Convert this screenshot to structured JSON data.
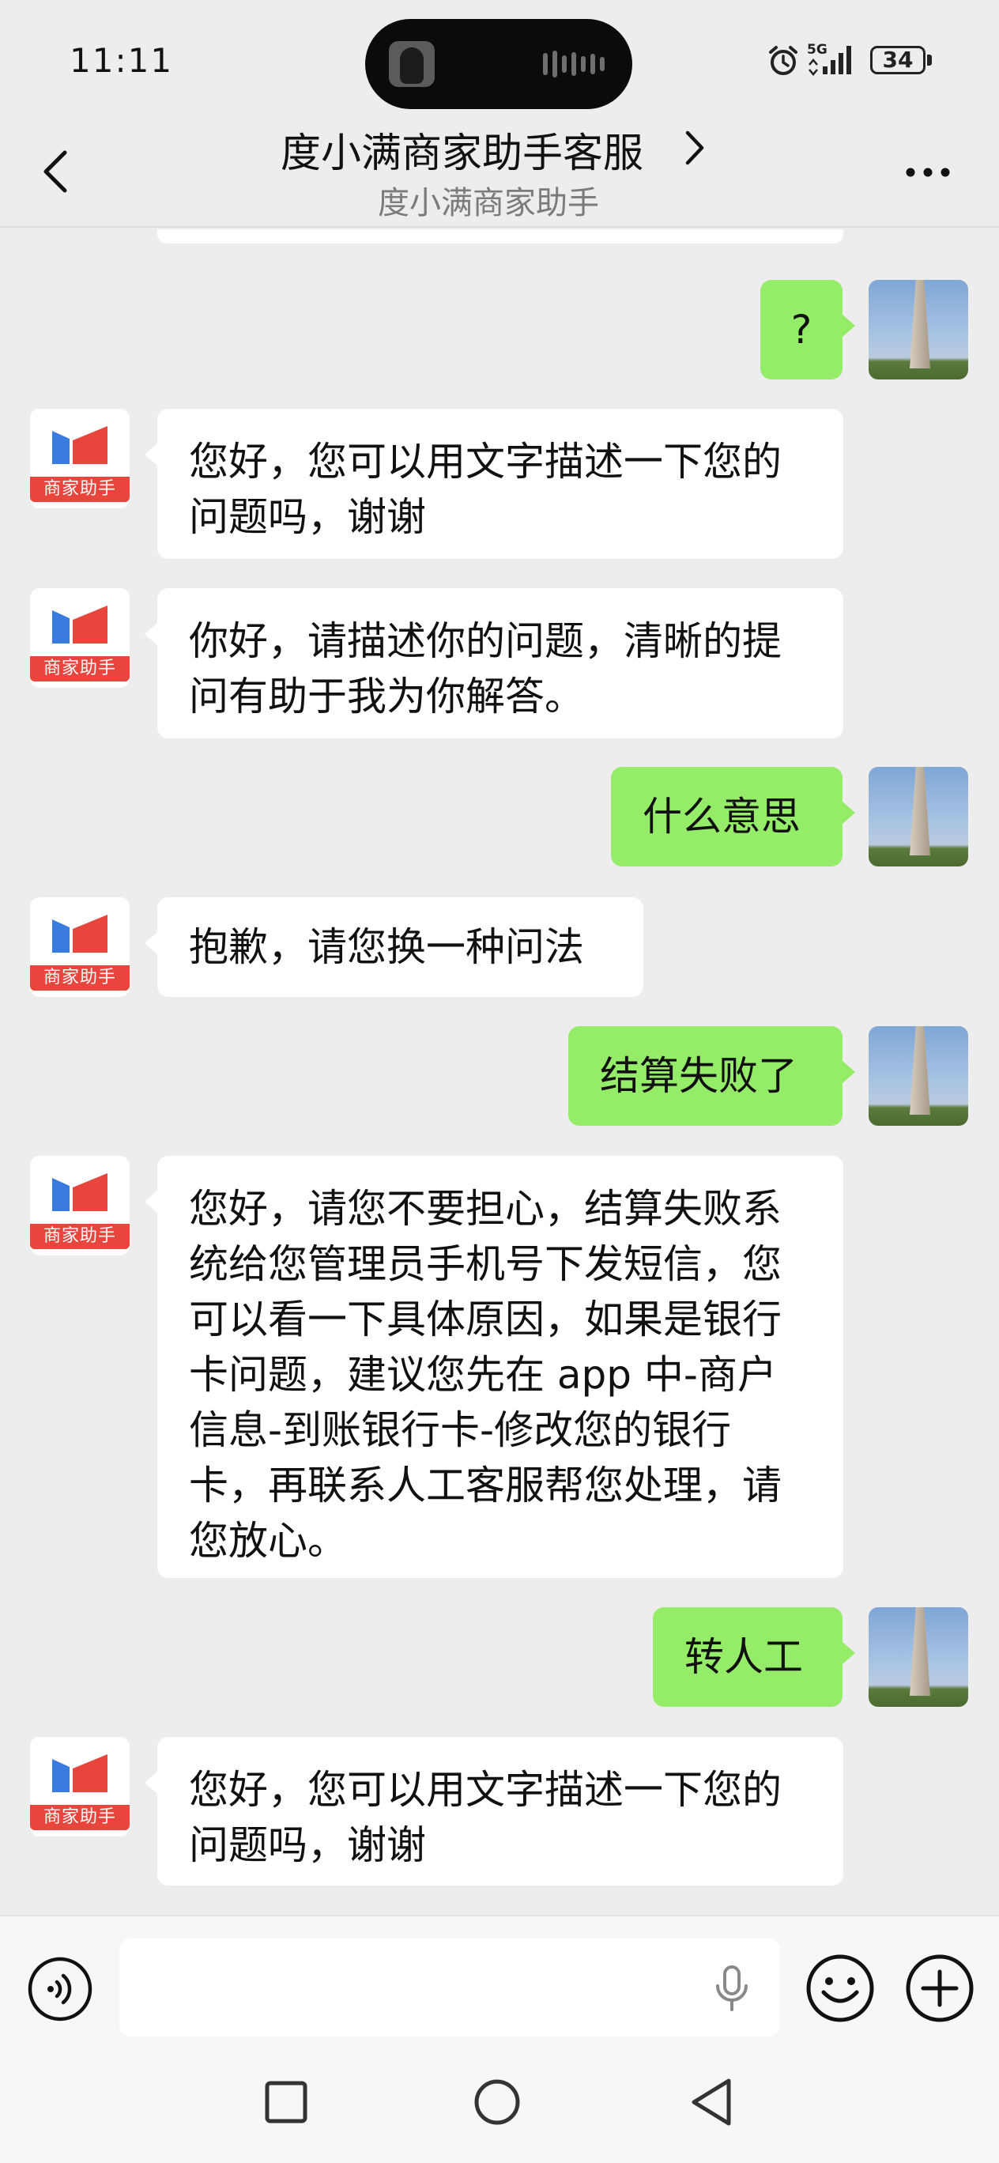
{
  "status_bar": {
    "time": "11:11",
    "network": "5G",
    "battery": "34"
  },
  "header": {
    "title": "度小满商家助手客服",
    "subtitle": "度小满商家助手"
  },
  "bot": {
    "badge": "商家助手"
  },
  "messages": [
    {
      "from": "user",
      "text": "?"
    },
    {
      "from": "bot",
      "text": "您好，您可以用文字描述一下您的\n问题吗，谢谢"
    },
    {
      "from": "bot",
      "text": "你好，请描述你的问题，清晰的提\n问有助于我为你解答。"
    },
    {
      "from": "user",
      "text": "什么意思"
    },
    {
      "from": "bot",
      "text": "抱歉，请您换一种问法"
    },
    {
      "from": "user",
      "text": "结算失败了"
    },
    {
      "from": "bot",
      "text": "您好，请您不要担心，结算失败系\n统给您管理员手机号下发短信，您\n可以看一下具体原因，如果是银行\n卡问题，建议您先在 app 中-商户\n信息-到账银行卡-修改您的银行\n卡，再联系人工客服帮您处理，请\n您放心。"
    },
    {
      "from": "user",
      "text": "转人工"
    },
    {
      "from": "bot",
      "text": "您好，您可以用文字描述一下您的\n问题吗，谢谢"
    }
  ],
  "input": {
    "value": ""
  }
}
